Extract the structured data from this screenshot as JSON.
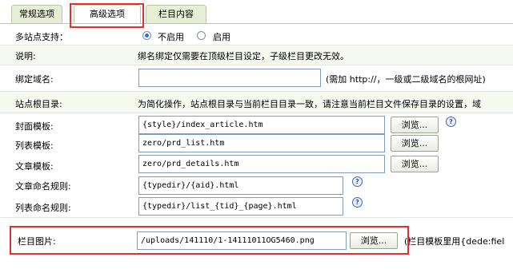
{
  "tabs": [
    "常规选项",
    "高级选项",
    "栏目内容"
  ],
  "multisite": {
    "label": "多站点支持：",
    "option_off": "不启用",
    "option_on": "启用",
    "selected": "不启用"
  },
  "note": {
    "label": "说明:",
    "text": "绑名绑定仅需要在顶级栏目设定，子级栏目更改无效。"
  },
  "bind_domain": {
    "label": "绑定域名:",
    "value": "",
    "hint": "(需加 http://，一级或二级域名的根网址)"
  },
  "site_root": {
    "label": "站点根目录:",
    "text": "为简化操作，站点根目录与当前栏目目录一致，请注意当前栏目文件保存目录的设置，域"
  },
  "cover_tpl": {
    "label": "封面模板:",
    "value": "{style}/index_article.htm",
    "button": "浏览..."
  },
  "list_tpl": {
    "label": "列表模板:",
    "value": "zero/prd_list.htm",
    "button": "浏览..."
  },
  "article_tpl": {
    "label": "文章模板:",
    "value": "zero/prd_details.htm",
    "button": "浏览..."
  },
  "article_rule": {
    "label": "文章命名规则:",
    "value": "{typedir}/{aid}.html"
  },
  "list_rule": {
    "label": "列表命名规则:",
    "value": "{typedir}/list_{tid}_{page}.html"
  },
  "column_image": {
    "label": "栏目图片:",
    "value": "/uploads/141110/1-14111011OG5460.png",
    "button": "浏览...",
    "hint": "(栏目模板里用{dede:fiel"
  },
  "icons": {
    "help": "help-icon",
    "radio": "radio-icon"
  },
  "colors": {
    "highlight_red": "#e0302f",
    "row_green": "#f6f9f0",
    "tab_green": "#e6efd6"
  }
}
